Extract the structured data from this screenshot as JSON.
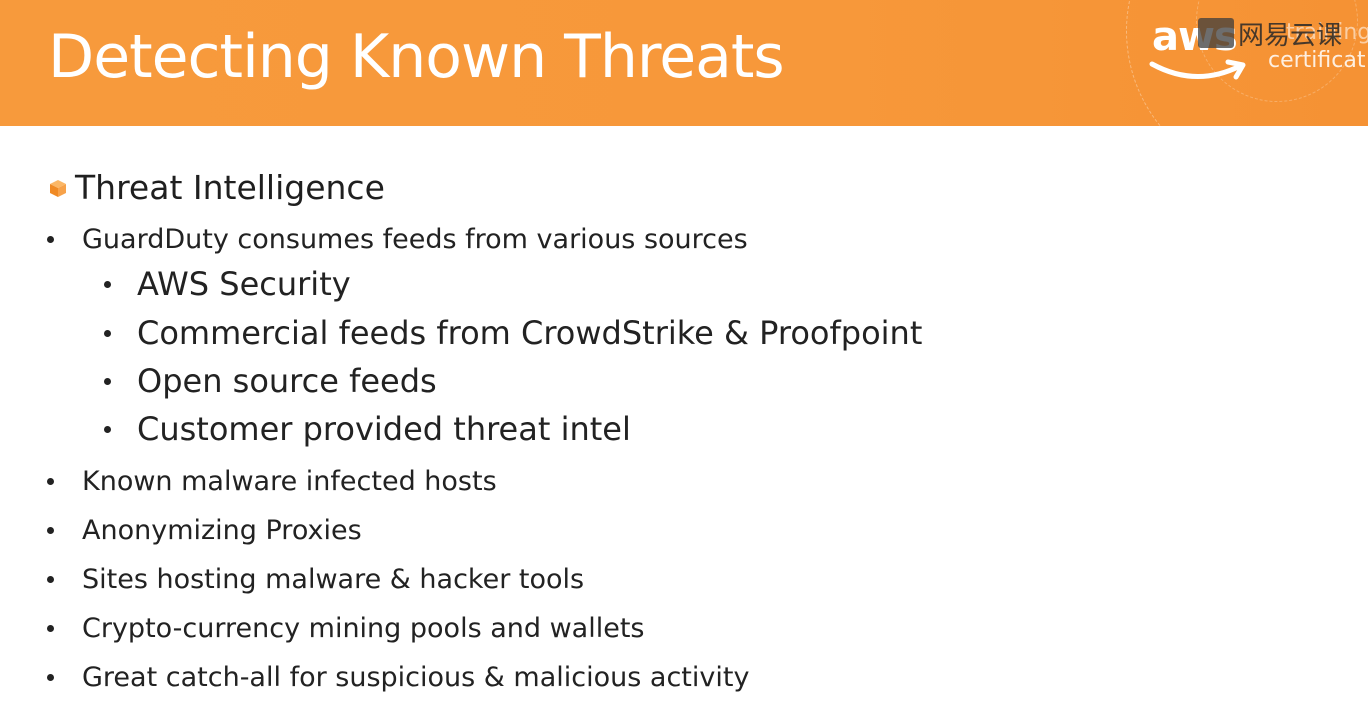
{
  "slide": {
    "title": "Detecting Known Threats",
    "brand": {
      "logo": "aws",
      "subtitle_top": "training",
      "subtitle": "certificat",
      "watermark": "网易云课"
    },
    "colors": {
      "header": "#f7983a",
      "text": "#222222",
      "bullet_icon": "#f7983a"
    },
    "section": {
      "icon": "cube-icon",
      "heading": "Threat Intelligence"
    },
    "bullets": [
      {
        "text": "GuardDuty consumes feeds from various sources",
        "children": [
          {
            "text": "AWS Security"
          },
          {
            "text": "Commercial feeds from CrowdStrike & Proofpoint"
          },
          {
            "text": "Open source feeds"
          },
          {
            "text": "Customer provided threat intel"
          }
        ]
      },
      {
        "text": "Known malware infected hosts"
      },
      {
        "text": "Anonymizing Proxies"
      },
      {
        "text": "Sites hosting malware & hacker tools"
      },
      {
        "text": "Crypto-currency mining pools and wallets"
      },
      {
        "text": "Great catch-all for suspicious & malicious activity"
      }
    ]
  }
}
